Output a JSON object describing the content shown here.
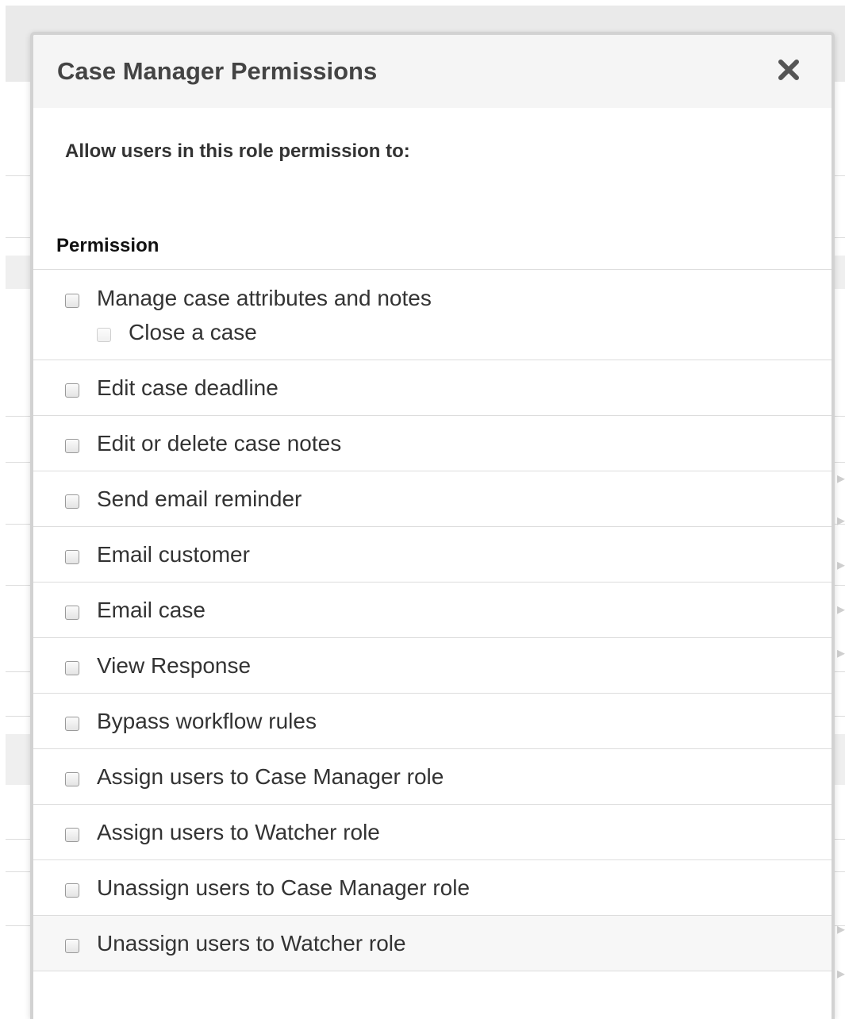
{
  "modal": {
    "title": "Case Manager Permissions",
    "close_icon": "close-icon",
    "intro": "Allow users in this role permission to:",
    "column_header": "Permission"
  },
  "permissions": [
    {
      "label": "Manage case attributes and notes",
      "checked": false,
      "sub": {
        "label": "Close a case",
        "checked": false,
        "disabled": true
      }
    },
    {
      "label": "Edit case deadline",
      "checked": false
    },
    {
      "label": "Edit or delete case notes",
      "checked": false
    },
    {
      "label": "Send email reminder",
      "checked": false
    },
    {
      "label": "Email customer",
      "checked": false
    },
    {
      "label": "Email case",
      "checked": false
    },
    {
      "label": "View Response",
      "checked": false
    },
    {
      "label": "Bypass workflow rules",
      "checked": false
    },
    {
      "label": "Assign users to Case Manager role",
      "checked": false
    },
    {
      "label": "Assign users to Watcher role",
      "checked": false
    },
    {
      "label": "Unassign users to Case Manager role",
      "checked": false
    },
    {
      "label": "Unassign users to Watcher role",
      "checked": false
    }
  ],
  "colors": {
    "header_bg": "#f5f5f5",
    "border": "#dddddd",
    "text": "#333333"
  }
}
